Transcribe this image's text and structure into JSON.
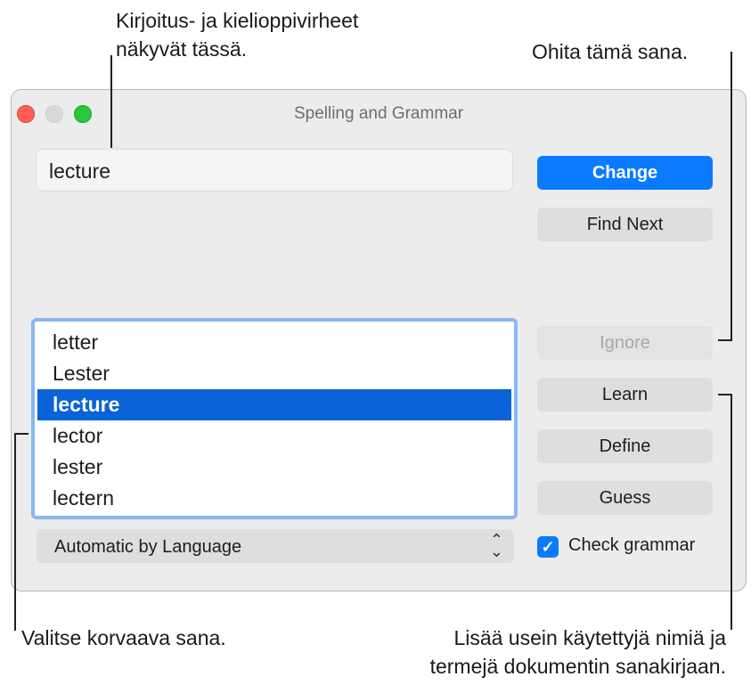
{
  "callouts": {
    "errors_line1": "Kirjoitus- ja kielioppivirheet",
    "errors_line2": "näkyvät tässä.",
    "ignore": "Ohita tämä sana.",
    "choose": "Valitse korvaava sana.",
    "learn_line1": "Lisää usein käytettyjä nimiä ja",
    "learn_line2": "termejä dokumentin sanakirjaan."
  },
  "window": {
    "title": "Spelling and Grammar",
    "misspelled_word": "lecture",
    "buttons": {
      "change": "Change",
      "find_next": "Find Next",
      "ignore": "Ignore",
      "learn": "Learn",
      "define": "Define",
      "guess": "Guess"
    },
    "suggestions": [
      "letter",
      "Lester",
      "lecture",
      "lector",
      "lester",
      "lectern"
    ],
    "selected_suggestion": "lecture",
    "language_popup": "Automatic by Language",
    "check_grammar": {
      "label": "Check grammar",
      "checked": true
    }
  },
  "colors": {
    "accent": "#0a7aff",
    "selection": "#0a63d8",
    "focus_ring": "#8bb6f2"
  }
}
